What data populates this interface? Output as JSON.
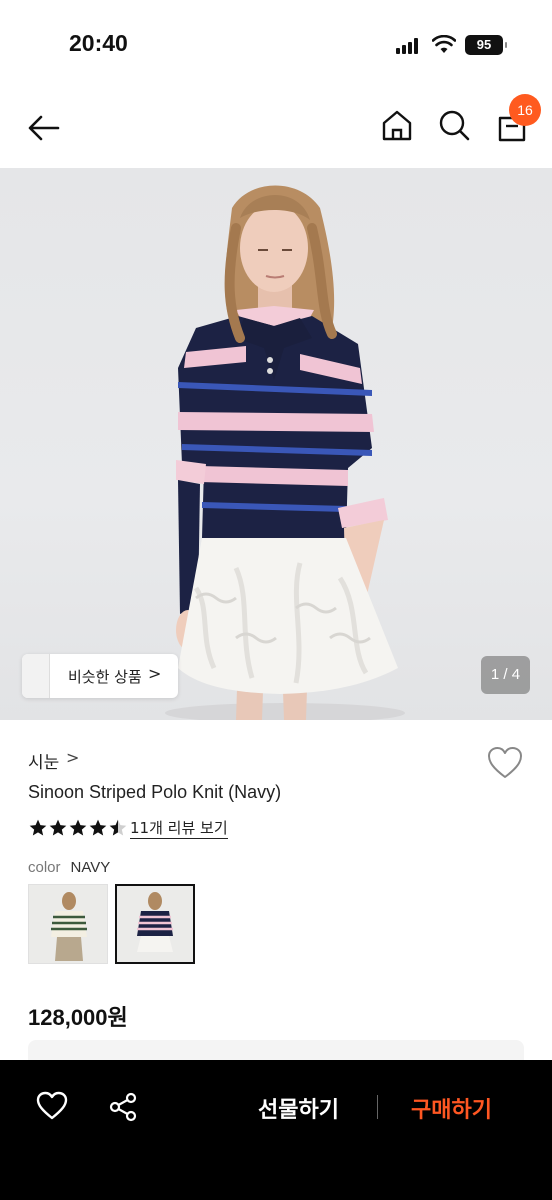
{
  "status_bar": {
    "time": "20:40",
    "battery": "95"
  },
  "nav": {
    "cart_count": "16"
  },
  "photo": {
    "similar_label": "비슷한 상품",
    "similar_chevron": ">",
    "page_indicator": "1 / 4"
  },
  "product": {
    "brand": "시눈",
    "brand_chevron": ">",
    "title": "Sinoon Striped Polo Knit (Navy)",
    "rating": 4.5,
    "review_link": "11개 리뷰 보기",
    "color_label": "color",
    "color_value": "NAVY",
    "price": "128,000원"
  },
  "bottom_bar": {
    "gift_label": "선물하기",
    "buy_label": "구매하기"
  },
  "colors": {
    "accent": "#ff5a1f",
    "buy": "#ff5722",
    "navy": "#1c2244",
    "pink": "#f0c4d4"
  }
}
